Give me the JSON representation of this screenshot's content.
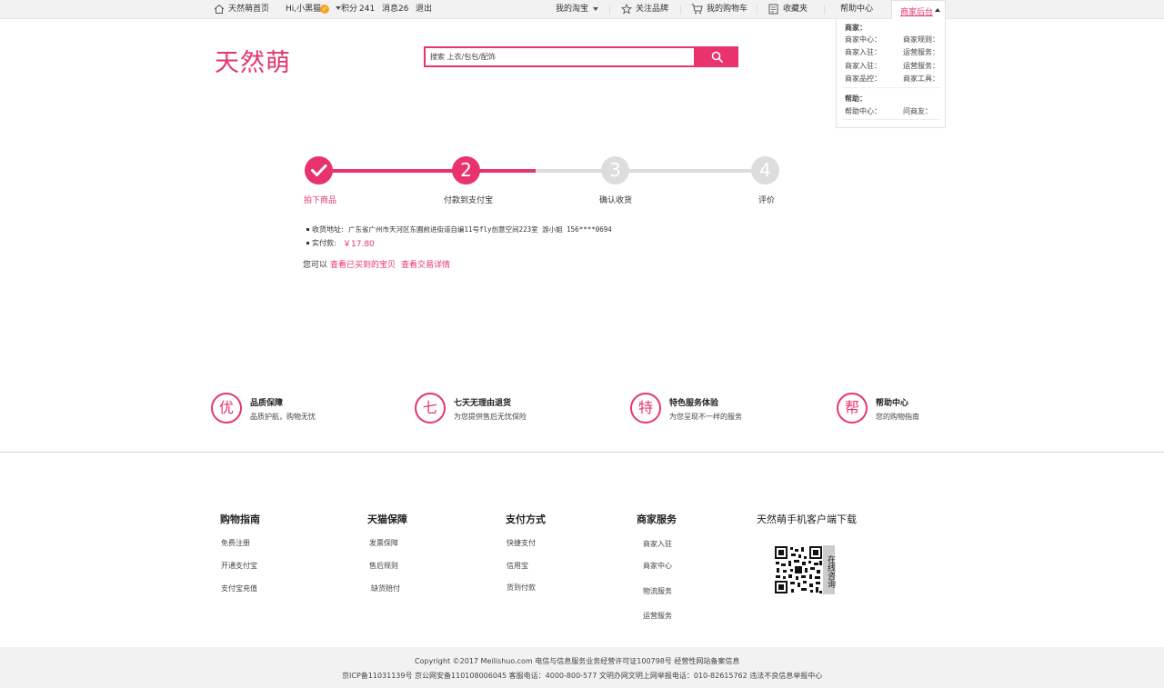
{
  "topbar": {
    "home": "天然萌首页",
    "greeting": "Hi,小黑猫",
    "points_label": "积分",
    "points_value": "241",
    "messages": "消息26",
    "logout": "退出",
    "my_taobao": "我的淘宝",
    "follow_brand": "关注品牌",
    "cart": "我的购物车",
    "favorites": "收藏夹",
    "help_center": "帮助中心",
    "seller_center": "商家后台"
  },
  "dropdown": {
    "merchant_heading": "商家：",
    "merchant_items": [
      "商家中心：",
      "商家规则：",
      "商家入驻：",
      "运营服务：",
      "商家入驻：",
      "运营服务：",
      "商家品控：",
      "商家工具："
    ],
    "help_heading": "帮助：",
    "help_items": [
      "帮助中心：",
      "问商友："
    ]
  },
  "header": {
    "logo": "天然萌",
    "search_value": "搜索 上衣/包包/配饰"
  },
  "steps": {
    "items": [
      {
        "num": "",
        "label": "拍下商品"
      },
      {
        "num": "2",
        "label": "付款到支付宝"
      },
      {
        "num": "3",
        "label": "确认收货"
      },
      {
        "num": "4",
        "label": "评价"
      }
    ],
    "current": 2
  },
  "order": {
    "address_label": "收货地址:",
    "address_value": "广东省广州市天河区东圃前进街道自编11号fly创意空间223室  游小姐  156****0694",
    "paid_label": "实付款:",
    "paid_value": "￥17.80",
    "hint_prefix": "您可以",
    "link_bought": "查看已买到的宝贝",
    "link_detail": "查看交易详情"
  },
  "features": [
    {
      "icon": "优",
      "title": "品质保障",
      "desc": "品质护航，购物无忧"
    },
    {
      "icon": "七",
      "title": "七天无理由退货",
      "desc": "为您提供售后无忧保险"
    },
    {
      "icon": "特",
      "title": "特色服务体验",
      "desc": "为您呈现不一样的服务"
    },
    {
      "icon": "帮",
      "title": "帮助中心",
      "desc": "您的购物指南"
    }
  ],
  "footer": {
    "columns": [
      {
        "title": "购物指南",
        "items": [
          "免费注册",
          "开通支付宝",
          "支付宝充值"
        ]
      },
      {
        "title": "天猫保障",
        "items": [
          "发票保障",
          "售后规则",
          "缺货赔付"
        ]
      },
      {
        "title": "支付方式",
        "items": [
          "快捷支付",
          "信用宝",
          "货到付款"
        ]
      },
      {
        "title": "商家服务",
        "items": [
          "商家入驻",
          "商家中心",
          "物流服务",
          "运营服务"
        ]
      }
    ],
    "app_title": "天然萌手机客户端下载",
    "qr_tag": "在线咨询",
    "copyright_1": "Copyright ©2017 Meilishuo.com  电信与信息服务业务经营许可证100798号  经营性网站备案信息",
    "copyright_2": "京ICP备11031139号  京公网安备110108006045  客服电话：4000-800-577  文明办网文明上网举报电话：010-82615762  违法不良信息举报中心"
  },
  "colors": {
    "accent": "#e8336d",
    "inactive": "#dddddd"
  }
}
